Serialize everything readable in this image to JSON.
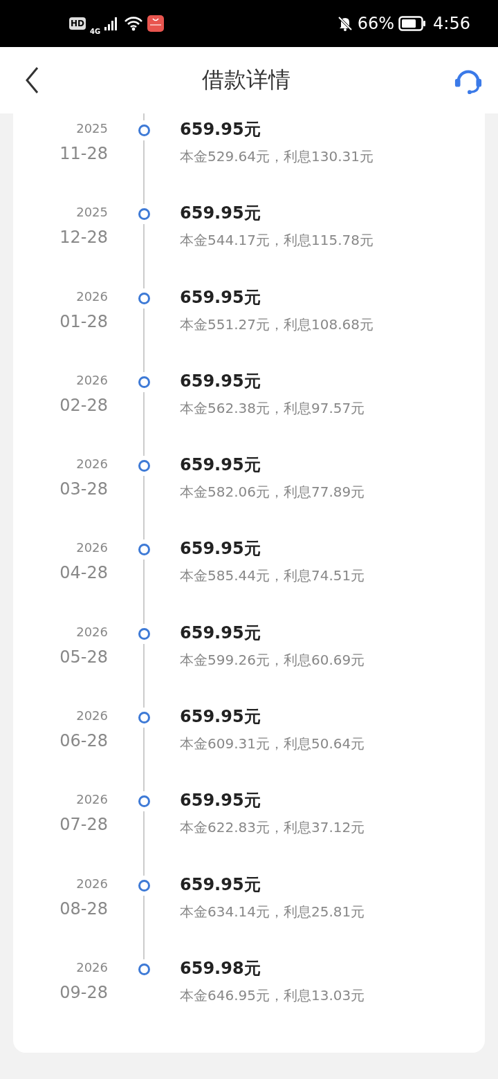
{
  "status_bar": {
    "hd": "HD",
    "network": "4G",
    "battery": "66%",
    "time": "4:56"
  },
  "header": {
    "title": "借款详情"
  },
  "schedule": [
    {
      "year": "2025",
      "date": "11-28",
      "amount": "659.95元",
      "detail": "本金529.64元，利息130.31元"
    },
    {
      "year": "2025",
      "date": "12-28",
      "amount": "659.95元",
      "detail": "本金544.17元，利息115.78元"
    },
    {
      "year": "2026",
      "date": "01-28",
      "amount": "659.95元",
      "detail": "本金551.27元，利息108.68元"
    },
    {
      "year": "2026",
      "date": "02-28",
      "amount": "659.95元",
      "detail": "本金562.38元，利息97.57元"
    },
    {
      "year": "2026",
      "date": "03-28",
      "amount": "659.95元",
      "detail": "本金582.06元，利息77.89元"
    },
    {
      "year": "2026",
      "date": "04-28",
      "amount": "659.95元",
      "detail": "本金585.44元，利息74.51元"
    },
    {
      "year": "2026",
      "date": "05-28",
      "amount": "659.95元",
      "detail": "本金599.26元，利息60.69元"
    },
    {
      "year": "2026",
      "date": "06-28",
      "amount": "659.95元",
      "detail": "本金609.31元，利息50.64元"
    },
    {
      "year": "2026",
      "date": "07-28",
      "amount": "659.95元",
      "detail": "本金622.83元，利息37.12元"
    },
    {
      "year": "2026",
      "date": "08-28",
      "amount": "659.95元",
      "detail": "本金634.14元，利息25.81元"
    },
    {
      "year": "2026",
      "date": "09-28",
      "amount": "659.98元",
      "detail": "本金646.95元，利息13.03元"
    }
  ]
}
